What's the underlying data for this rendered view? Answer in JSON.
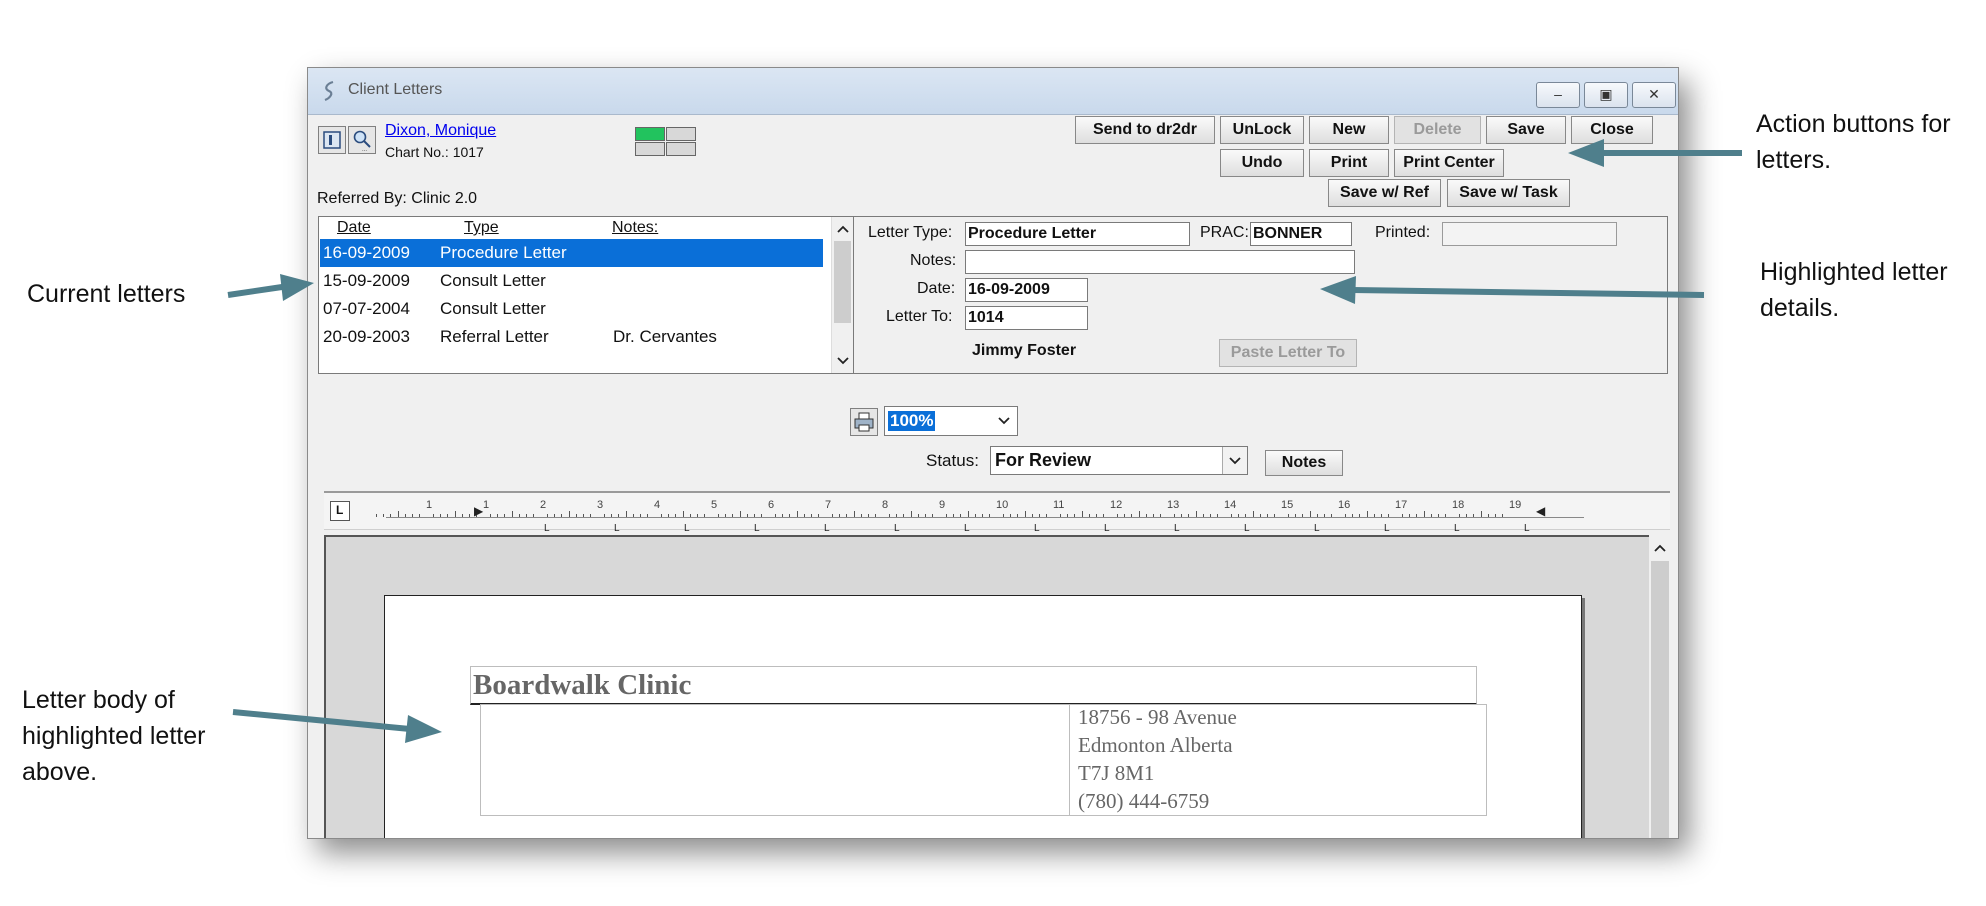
{
  "callouts": {
    "action_buttons": "Action buttons for\nletters.",
    "current_letters": "Current letters",
    "highlighted_details": "Highlighted letter\ndetails.",
    "letter_body": "Letter body of\nhighlighted letter\nabove."
  },
  "window": {
    "title": "Client Letters",
    "controls": {
      "minimize": "–",
      "maximize": "▣",
      "close": "✕"
    }
  },
  "patient": {
    "name": "Dixon, Monique",
    "chart": "Chart No.: 1017",
    "referred_by": "Referred By: Clinic 2.0"
  },
  "toolbar": {
    "send": "Send to dr2dr",
    "unlock": "UnLock",
    "new": "New",
    "delete": "Delete",
    "save": "Save",
    "close": "Close",
    "undo": "Undo",
    "print": "Print",
    "print_center": "Print Center",
    "save_ref": "Save w/ Ref",
    "save_task": "Save w/ Task"
  },
  "letters": {
    "headers": {
      "date": "Date",
      "type": "Type",
      "notes": "Notes:"
    },
    "rows": [
      {
        "date": "16-09-2009",
        "type": "Procedure Letter",
        "notes": ""
      },
      {
        "date": "15-09-2009",
        "type": "Consult Letter",
        "notes": ""
      },
      {
        "date": "07-07-2004",
        "type": "Consult Letter",
        "notes": ""
      },
      {
        "date": "20-09-2003",
        "type": "Referral Letter",
        "notes": "Dr. Cervantes"
      }
    ]
  },
  "details": {
    "letter_type_label": "Letter Type:",
    "letter_type": "Procedure Letter",
    "prac_label": "PRAC:",
    "prac": "BONNER",
    "printed_label": "Printed:",
    "printed": "",
    "notes_label": "Notes:",
    "notes": "",
    "date_label": "Date:",
    "date": "16-09-2009",
    "letter_to_label": "Letter To:",
    "letter_to": "1014",
    "recipient_name": "Jimmy Foster",
    "paste_button": "Paste Letter To"
  },
  "view": {
    "zoom": "100%",
    "status_label": "Status:",
    "status": "For Review",
    "notes_button": "Notes"
  },
  "ruler": {
    "numbers": [
      "1",
      "1",
      "2",
      "3",
      "4",
      "5",
      "6",
      "7",
      "8",
      "9",
      "10",
      "11",
      "12",
      "13",
      "14",
      "15",
      "16",
      "17",
      "18",
      "19"
    ],
    "tab_symbol": "L"
  },
  "letter_doc": {
    "clinic_name": "Boardwalk Clinic",
    "address_lines": [
      "18756 - 98 Avenue",
      "Edmonton Alberta",
      "T7J 8M1",
      "(780) 444-6759"
    ]
  },
  "colors": {
    "selection": "#0a6fd8",
    "arrow": "#4f7f8c",
    "indicator_on": "#22c35e"
  }
}
